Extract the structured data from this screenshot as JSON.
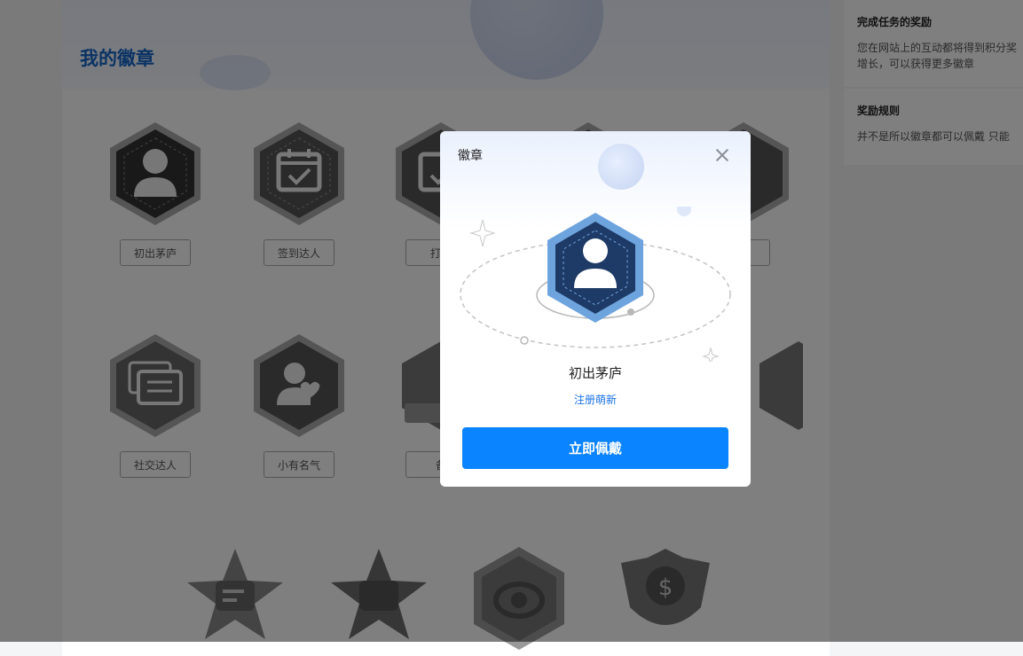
{
  "page": {
    "title": "我的徽章"
  },
  "badges": [
    {
      "label": "初出茅庐",
      "icon": "user-icon"
    },
    {
      "label": "签到达人",
      "icon": "calendar-check-icon"
    },
    {
      "label": "打卡",
      "icon": "calendar-check-icon"
    },
    {
      "label": "",
      "icon": "hexagon-badge-icon"
    },
    {
      "label": "",
      "icon": "hexagon-badge-icon"
    },
    {
      "label": "社交达人",
      "icon": "chat-icon"
    },
    {
      "label": "小有名气",
      "icon": "user-heart-icon"
    },
    {
      "label": "备",
      "icon": "ribbon-badge-icon"
    },
    {
      "label": "",
      "icon": "ribbon-badge-icon"
    },
    {
      "label": "",
      "icon": "ribbon-badge-icon"
    },
    {
      "label": "",
      "icon": "star-comment-icon"
    },
    {
      "label": "",
      "icon": "star-comment-icon"
    },
    {
      "label": "",
      "icon": "eye-icon"
    },
    {
      "label": "",
      "icon": "coin-icon"
    }
  ],
  "sidebar": {
    "reward": {
      "title": "完成任务的奖励",
      "lines": [
        "您在网站上的互动都将得到积分奖",
        "增长，可以获得更多徽章"
      ]
    },
    "rules": {
      "title": "奖励规则",
      "lines": [
        "并不是所以徽章都可以佩戴 只能"
      ]
    }
  },
  "modal": {
    "title": "徽章",
    "badge_name": "初出茅庐",
    "badge_desc": "注册萌新",
    "wear_button": "立即佩戴",
    "close_icon": "close-icon"
  },
  "colors": {
    "accent": "#0a84ff",
    "title_blue": "#1566c9",
    "badge_navy": "#1e3a66",
    "badge_ring": "#6ea4de"
  }
}
